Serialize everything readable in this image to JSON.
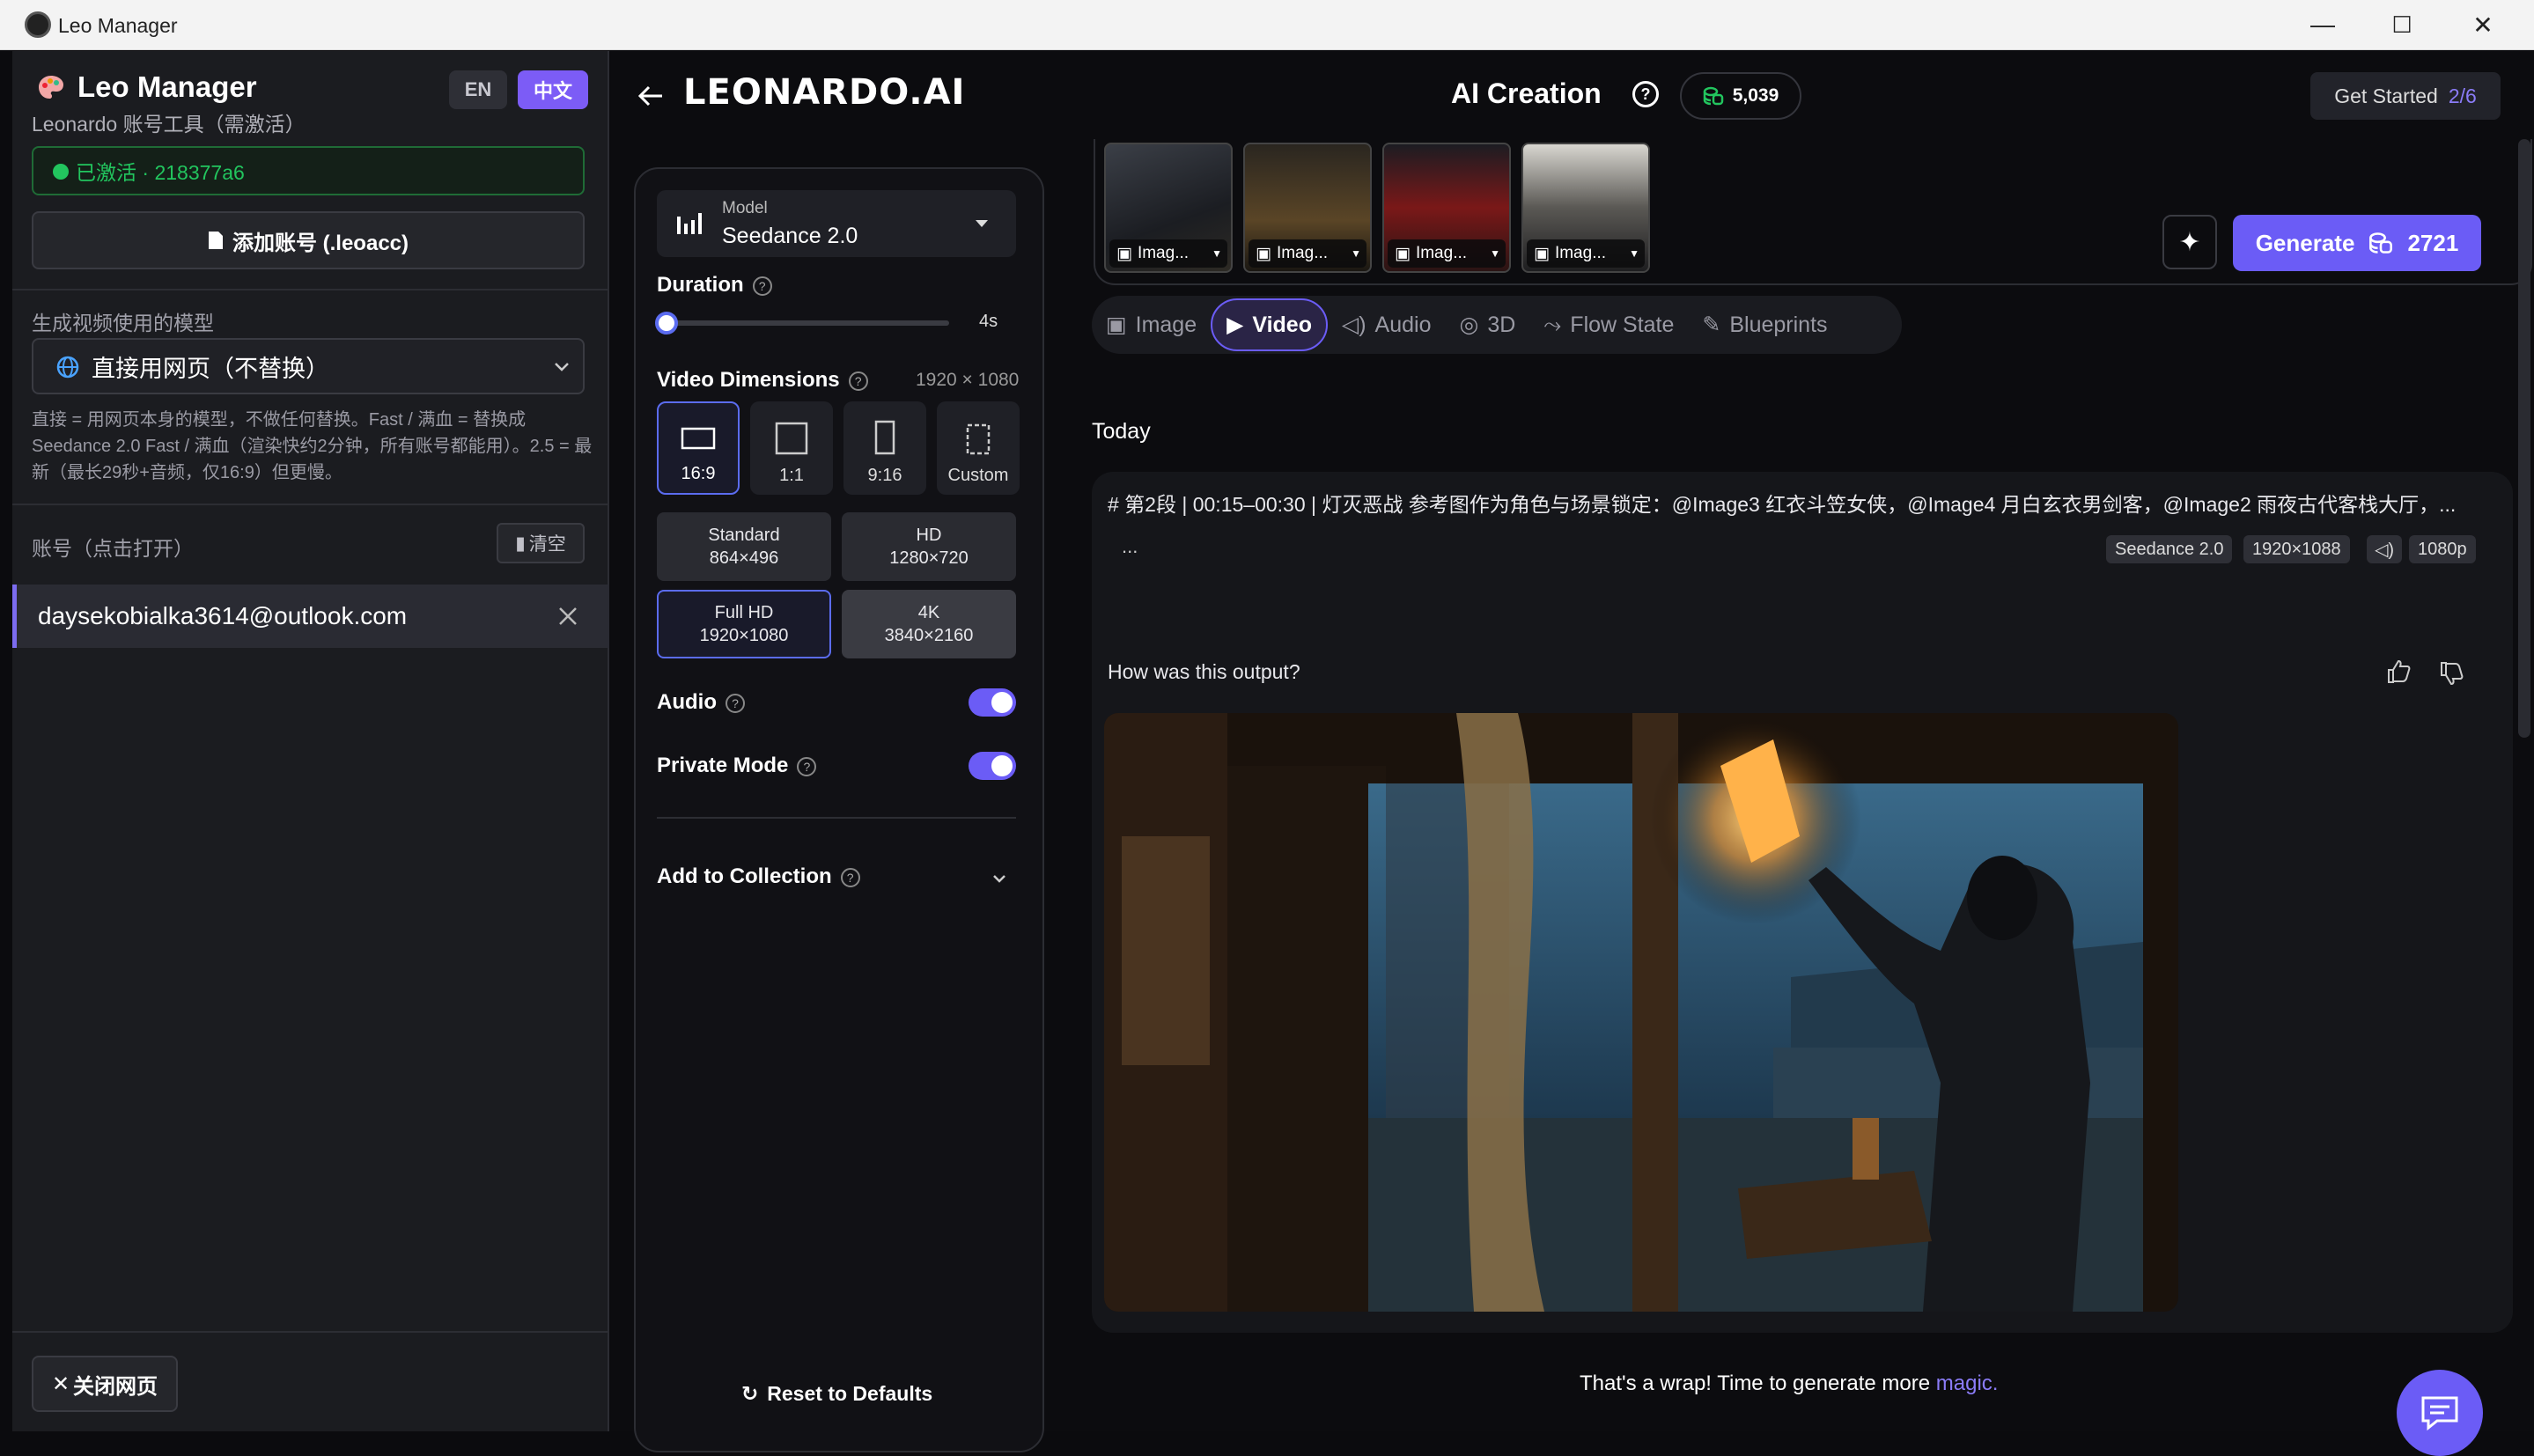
{
  "window": {
    "title": "Leo Manager",
    "minimize": "—",
    "maximize": "☐",
    "close": "✕"
  },
  "sidebar": {
    "app_name": "Leo Manager",
    "subtitle": "Leonardo 账号工具（需激活）",
    "lang_en": "EN",
    "lang_zh": "中文",
    "activation_status": "已激活 · 218377a6",
    "add_account_label": "添加账号 (.leoacc)",
    "model_section_label": "生成视频使用的模型",
    "model_select_value": "直接用网页（不替换）",
    "model_description": "直接 = 用网页本身的模型，不做任何替换。Fast / 满血 = 替换成 Seedance 2.0 Fast / 满血（渲染快约2分钟，所有账号都能用）。2.5 = 最新（最长29秒+音频，仅16:9）但更慢。",
    "accounts_label": "账号（点击打开）",
    "clear_label": "清空",
    "accounts": [
      "daysekobialka3614@outlook.com"
    ],
    "close_page_label": "关闭网页"
  },
  "header": {
    "logo": "LEONARDO.AI",
    "page_title": "AI Creation",
    "credits": "5,039",
    "get_started": "Get Started",
    "get_started_progress": "2/6"
  },
  "settings": {
    "model_label": "Model",
    "model_value": "Seedance 2.0",
    "duration_label": "Duration",
    "duration_value": "4s",
    "duration_fraction": 0.0,
    "dimensions_label": "Video Dimensions",
    "dimensions_value": "1920 × 1080",
    "aspect_ratios": [
      "16:9",
      "1:1",
      "9:16",
      "Custom"
    ],
    "resolutions": [
      {
        "name": "Standard",
        "size": "864×496"
      },
      {
        "name": "HD",
        "size": "1280×720"
      },
      {
        "name": "Full HD",
        "size": "1920×1080"
      },
      {
        "name": "4K",
        "size": "3840×2160"
      }
    ],
    "audio_label": "Audio",
    "audio_on": true,
    "private_label": "Private Mode",
    "private_on": true,
    "collection_label": "Add to Collection",
    "reset_label": "Reset to Defaults"
  },
  "thumbnails": [
    {
      "label": "Imag..."
    },
    {
      "label": "Imag..."
    },
    {
      "label": "Imag..."
    },
    {
      "label": "Imag..."
    }
  ],
  "generate": {
    "label": "Generate",
    "cost": "2721"
  },
  "tabs": [
    "Image",
    "Video",
    "Audio",
    "3D",
    "Flow State",
    "Blueprints"
  ],
  "feed": {
    "date_heading": "Today",
    "prompt": "# 第2段 | 00:15–00:30 | 灯灭恶战 参考图作为角色与场景锁定：@Image3 红衣斗笠女侠，@Image4 月白玄衣男剑客，@Image2 雨夜古代客栈大厅，...",
    "more": "...",
    "chips": [
      "Seedance 2.0",
      "1920×1088",
      "1080p"
    ],
    "feedback_question": "How was this output?",
    "footer_text": "That's a wrap! Time to generate more ",
    "footer_link": "magic."
  },
  "colors": {
    "accent": "#6b5cf6",
    "active_green": "#22c55e",
    "bg": "#0c0c0f"
  }
}
